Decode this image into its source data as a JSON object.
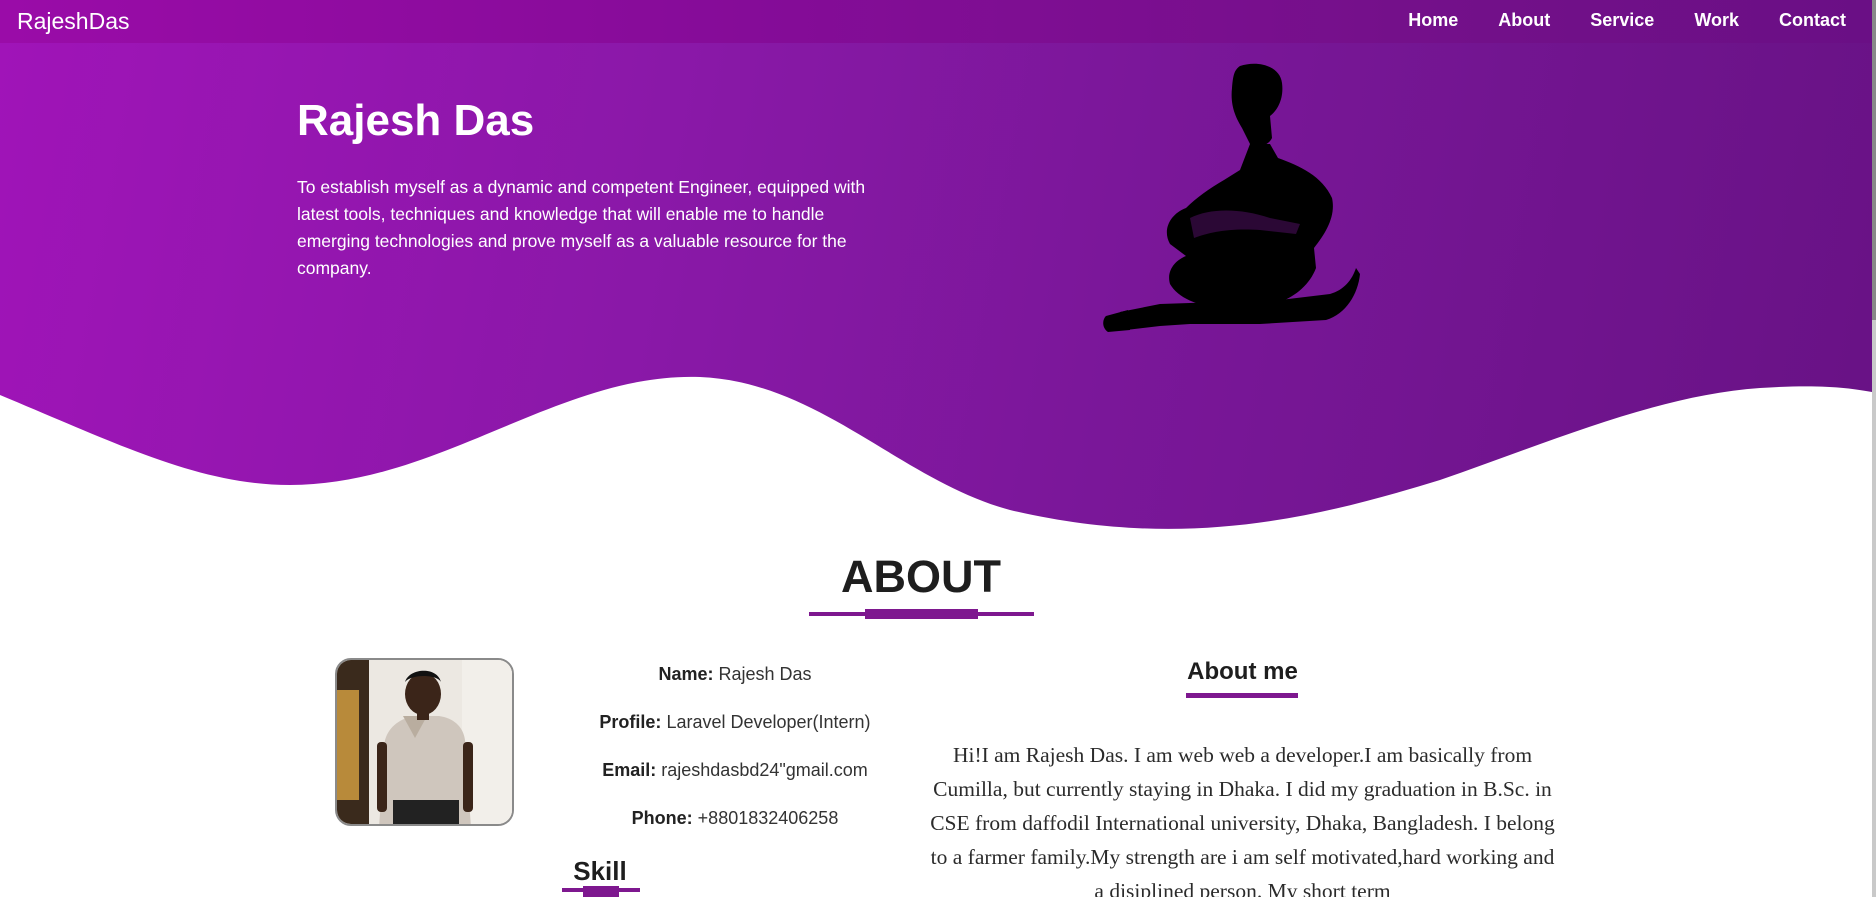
{
  "navbar": {
    "brand": "RajeshDas",
    "links": [
      "Home",
      "About",
      "Service",
      "Work",
      "Contact"
    ]
  },
  "hero": {
    "title": "Rajesh Das",
    "text": "To establish myself as a dynamic and competent Engineer, equipped with latest tools, techniques and knowledge that will enable me to handle emerging technologies and prove myself as a valuable resource for the company."
  },
  "about": {
    "title": "ABOUT",
    "info": [
      {
        "label": "Name:",
        "value": "Rajesh Das"
      },
      {
        "label": "Profile:",
        "value": "Laravel Developer(Intern)"
      },
      {
        "label": "Email:",
        "value": "rajeshdasbd24\"gmail.com"
      },
      {
        "label": "Phone:",
        "value": "+8801832406258"
      }
    ],
    "skill_title": "Skill",
    "about_me_title": "About me",
    "bio": "Hi!I am Rajesh Das. I am web web a developer.I am basically from Cumilla, but currently staying in Dhaka. I did my graduation in B.Sc. in CSE from daffodil International university, Dhaka, Bangladesh. I belong to a farmer family.My strength are i am self motivated,hard working and a disiplined person. My short term"
  },
  "colors": {
    "accent": "#7e188f",
    "hero_start": "#a014b8",
    "hero_end": "#681285"
  },
  "icons": {
    "hero_graphic": "warrior-silhouette-icon"
  }
}
